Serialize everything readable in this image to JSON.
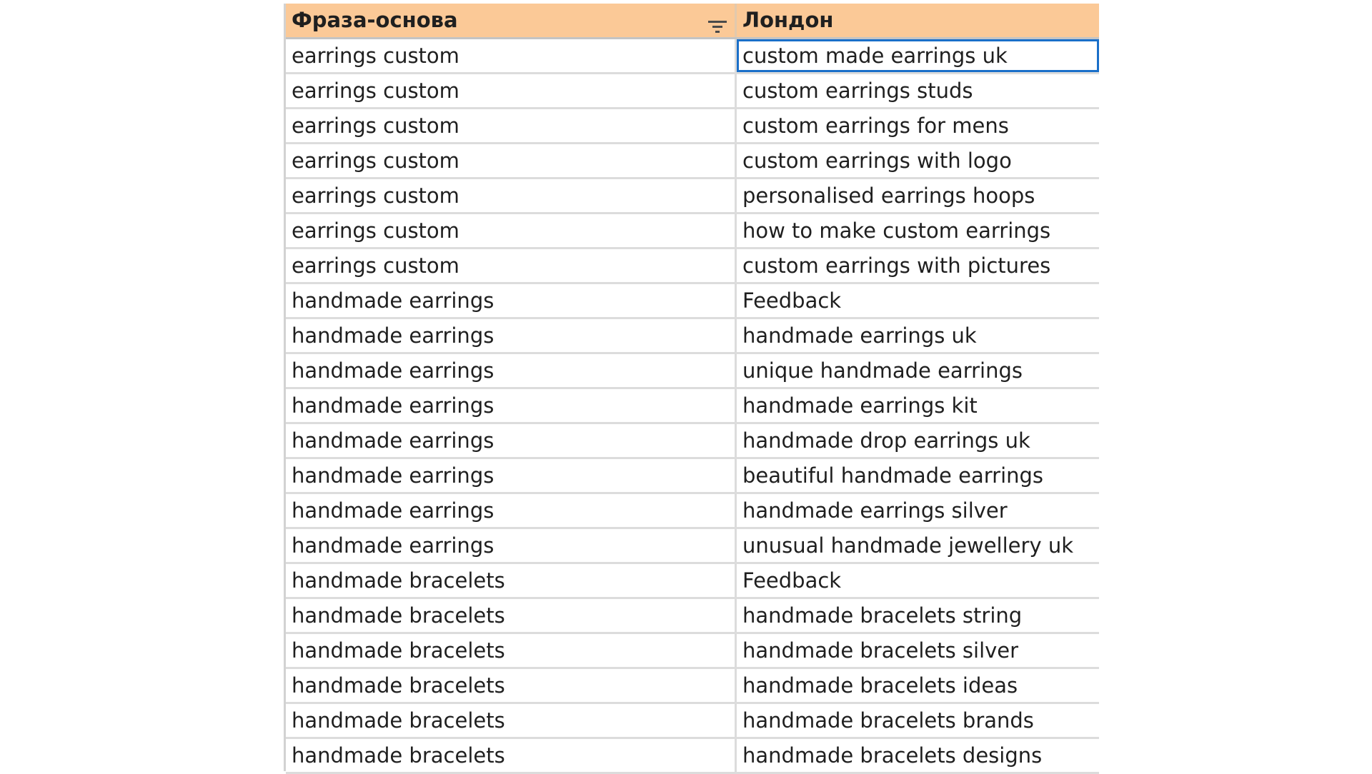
{
  "table": {
    "columns": [
      "Фраза-основа",
      "Лондон"
    ],
    "rows": [
      [
        "earrings custom",
        "custom made earrings uk"
      ],
      [
        "earrings custom",
        "custom earrings studs"
      ],
      [
        "earrings custom",
        "custom earrings for mens"
      ],
      [
        "earrings custom",
        "custom earrings with logo"
      ],
      [
        "earrings custom",
        "personalised earrings hoops"
      ],
      [
        "earrings custom",
        "how to make custom earrings"
      ],
      [
        "earrings custom",
        "custom earrings with pictures"
      ],
      [
        "handmade earrings",
        "Feedback"
      ],
      [
        "handmade earrings",
        "handmade earrings uk"
      ],
      [
        "handmade earrings",
        "unique handmade earrings"
      ],
      [
        "handmade earrings",
        "handmade earrings kit"
      ],
      [
        "handmade earrings",
        "handmade drop earrings uk"
      ],
      [
        "handmade earrings",
        "beautiful handmade earrings"
      ],
      [
        "handmade earrings",
        "handmade earrings silver"
      ],
      [
        "handmade earrings",
        "unusual handmade jewellery uk"
      ],
      [
        "handmade bracelets",
        "Feedback"
      ],
      [
        "handmade bracelets",
        "handmade bracelets string"
      ],
      [
        "handmade bracelets",
        "handmade bracelets silver"
      ],
      [
        "handmade bracelets",
        "handmade bracelets ideas"
      ],
      [
        "handmade bracelets",
        "handmade bracelets brands"
      ],
      [
        "handmade bracelets",
        "handmade bracelets designs"
      ]
    ]
  },
  "icons": {
    "filter": "filter-icon"
  },
  "colors": {
    "header_bg": "#fbc997",
    "selection_border": "#1a6fc9",
    "filter_icon": "#4a4a4a"
  }
}
